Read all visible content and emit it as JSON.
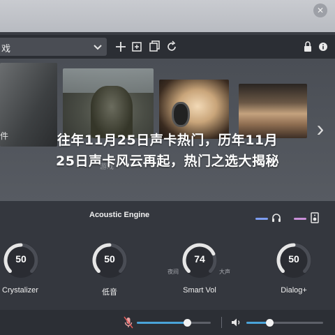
{
  "window": {
    "close_glyph": "✕"
  },
  "toolbar": {
    "dropdown_value": "戏",
    "icons": [
      "chevron-down-icon",
      "plus-icon",
      "add-frame-icon",
      "refresh-icon",
      "lock-icon",
      "info-icon"
    ]
  },
  "carousel": {
    "side_text": "件",
    "faded_subtitle": "游戏",
    "next_glyph": "›"
  },
  "headline": {
    "line1": "往年11月25日声卡热门，历年11月",
    "line2": "25日声卡风云再起，热门之选大揭秘"
  },
  "audio_panel": {
    "title": "Acoustic Engine",
    "knobs": [
      {
        "label": "Crystalizer",
        "value": "50",
        "level": 0.5
      },
      {
        "label": "低音",
        "value": "50",
        "level": 0.5
      },
      {
        "label": "Smart Vol",
        "value": "74",
        "level": 0.74,
        "min_label": "夜间",
        "max_label": "大声"
      },
      {
        "label": "Dialog+",
        "value": "50",
        "level": 0.5
      }
    ],
    "colors": {
      "accent_blue": "#7d9df0",
      "accent_pink": "#c98fd8",
      "knob_arc": "#e6e6e6",
      "knob_track": "#4a4d55"
    }
  },
  "bottom_bar": {
    "mic_level": 0.68,
    "volume_level": 0.3,
    "slider_color": "#4aa3d8"
  }
}
